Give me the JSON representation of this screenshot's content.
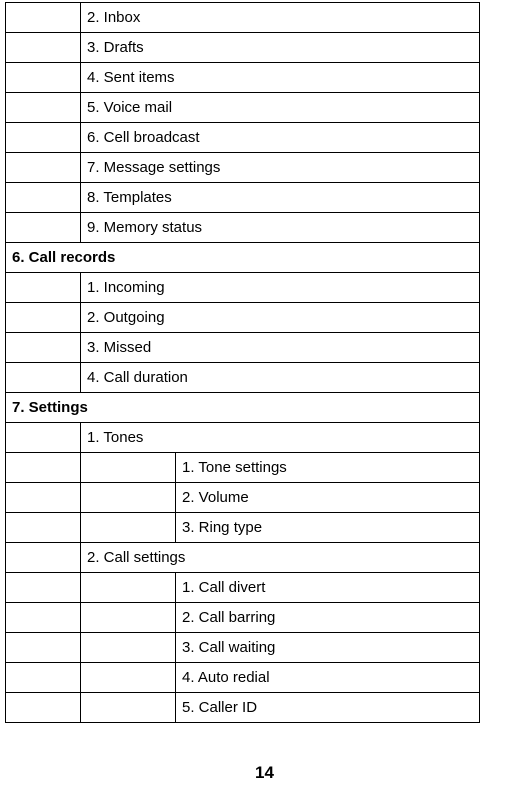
{
  "messages_items": [
    "2. Inbox",
    "3. Drafts",
    "4. Sent items",
    "5. Voice mail",
    "6. Cell broadcast",
    "7. Message settings",
    "8. Templates",
    "9. Memory status"
  ],
  "section6": "6. Call records",
  "call_records_items": [
    "1. Incoming",
    "2. Outgoing",
    "3. Missed",
    "4. Call duration"
  ],
  "section7": "7. Settings",
  "settings_tones_header": "1. Tones",
  "settings_tones_items": [
    "1. Tone settings",
    "2. Volume",
    "3. Ring type"
  ],
  "settings_call_header": "2. Call settings",
  "settings_call_items": [
    "1. Call divert",
    "2. Call barring",
    "3. Call waiting",
    "4. Auto redial",
    "5. Caller ID"
  ],
  "page_number": "14"
}
